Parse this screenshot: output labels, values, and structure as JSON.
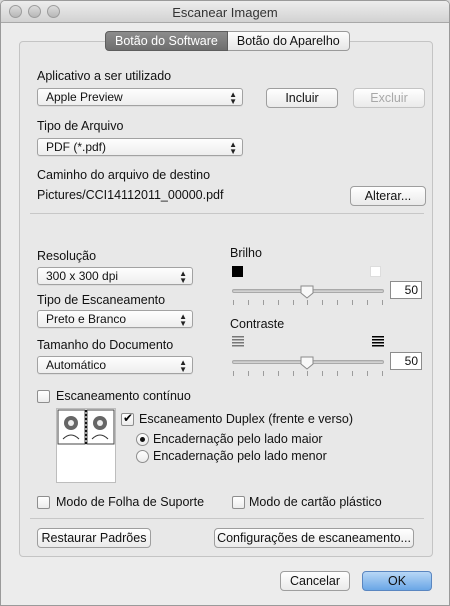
{
  "window": {
    "title": "Escanear Imagem"
  },
  "tabs": [
    {
      "label": "Botão do Software",
      "active": true
    },
    {
      "label": "Botão do Aparelho",
      "active": false
    }
  ],
  "app": {
    "label": "Aplicativo a ser utilizado",
    "selected": "Apple Preview",
    "add_label": "Incluir",
    "delete_label": "Excluir"
  },
  "file_type": {
    "label": "Tipo de Arquivo",
    "selected": "PDF (*.pdf)"
  },
  "destination": {
    "label": "Caminho do arquivo de destino",
    "path": "Pictures/CCI14112011_00000.pdf",
    "change_label": "Alterar..."
  },
  "resolution": {
    "label": "Resolução",
    "selected": "300 x 300 dpi"
  },
  "scan_type": {
    "label": "Tipo de Escaneamento",
    "selected": "Preto e Branco"
  },
  "doc_size": {
    "label": "Tamanho do Documento",
    "selected": "Automático"
  },
  "brightness": {
    "label": "Brilho",
    "value": "50"
  },
  "contrast": {
    "label": "Contraste",
    "value": "50"
  },
  "continuous": {
    "label": "Escaneamento contínuo",
    "checked": false
  },
  "duplex": {
    "label": "Escaneamento Duplex (frente e verso)",
    "checked": true,
    "long_edge": "Encadernação pelo lado maior",
    "short_edge": "Encadernação pelo lado menor",
    "selected": "long_edge"
  },
  "carrier_sheet": {
    "label": "Modo de Folha de Suporte",
    "checked": false
  },
  "plastic_card": {
    "label": "Modo de cartão plástico",
    "checked": false
  },
  "restore_label": "Restaurar Padrões",
  "scan_settings_label": "Configurações de escaneamento...",
  "cancel_label": "Cancelar",
  "ok_label": "OK",
  "colors": {
    "accent": "#6aa6e6",
    "panel": "#e8e8e8",
    "window": "#ececec"
  }
}
